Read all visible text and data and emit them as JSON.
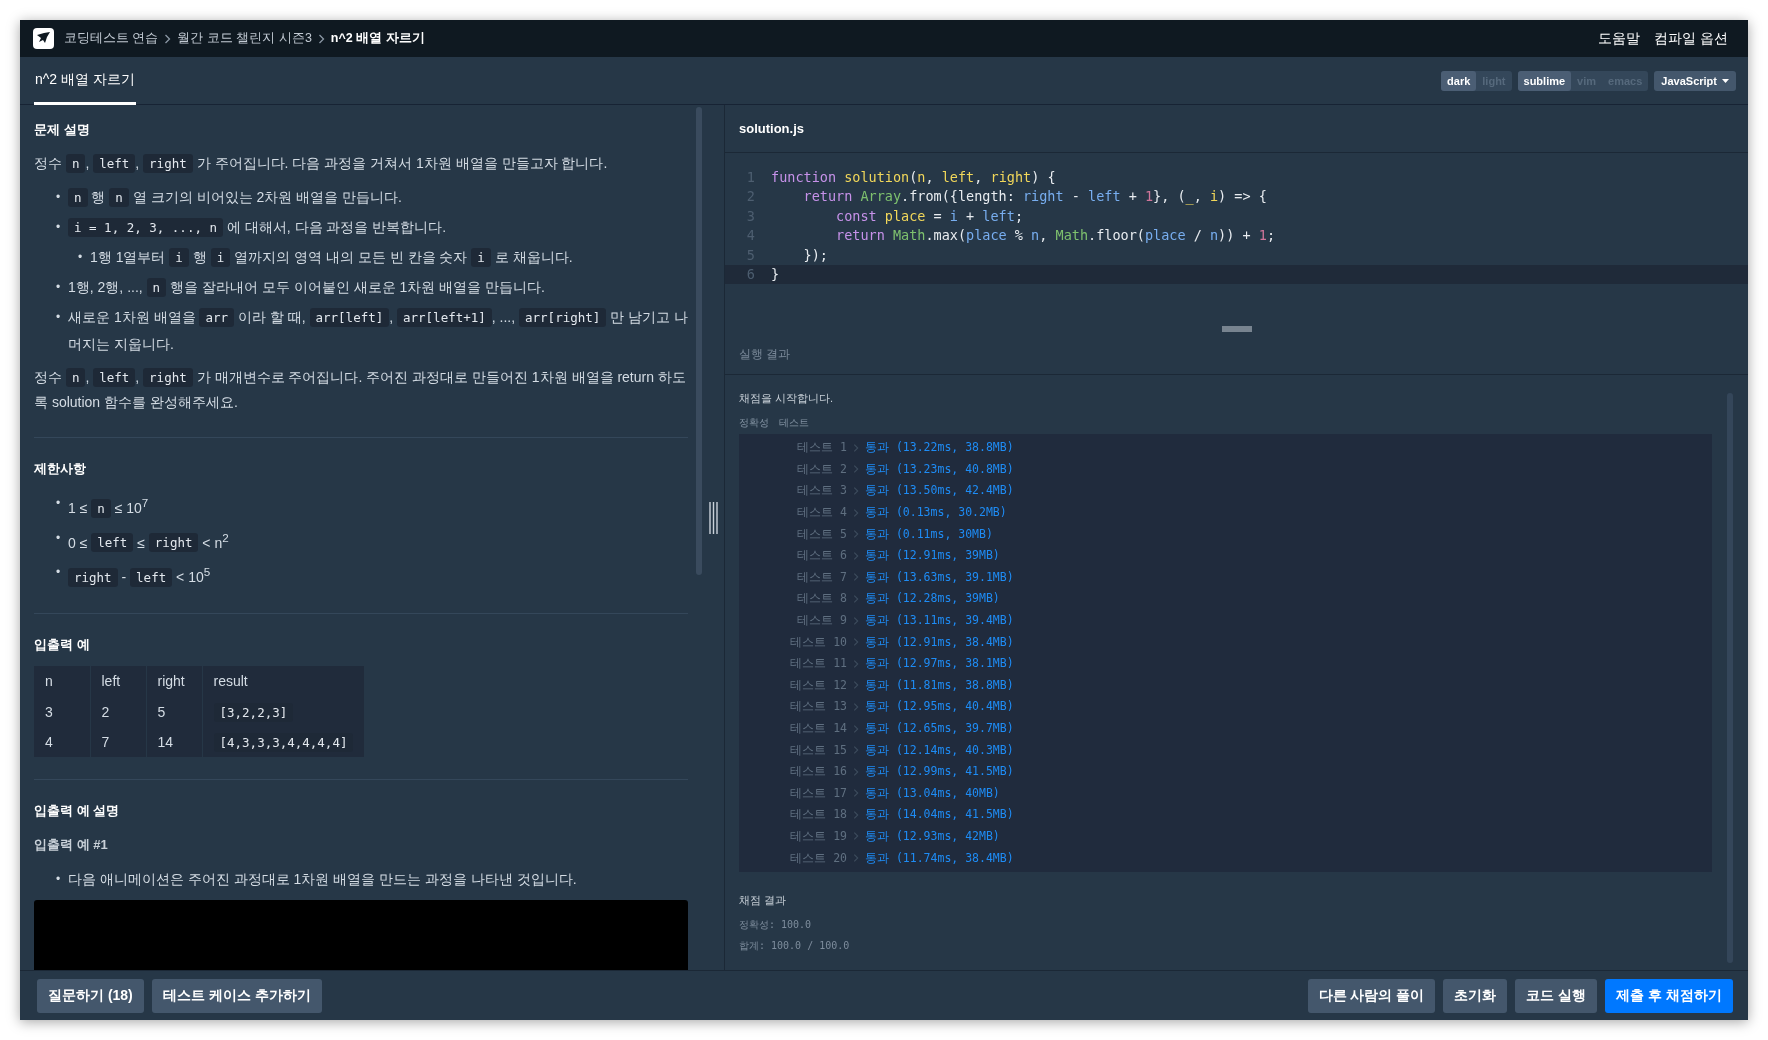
{
  "breadcrumb": [
    {
      "label": "코딩테스트 연습",
      "selected": false
    },
    {
      "label": "월간 코드 챌린지 시즌3",
      "selected": false
    },
    {
      "label": "n^2 배열 자르기",
      "selected": true
    }
  ],
  "top_links": [
    "도움말",
    "컴파일 옵션"
  ],
  "tabs": [
    {
      "label": "n^2 배열 자르기",
      "selected": true
    }
  ],
  "theme_options": [
    {
      "label": "dark",
      "selected": true
    },
    {
      "label": "light",
      "selected": false
    }
  ],
  "keymap_options": [
    {
      "label": "sublime",
      "selected": true
    },
    {
      "label": "vim",
      "selected": false
    },
    {
      "label": "emacs",
      "selected": false
    }
  ],
  "language": "JavaScript",
  "problem": {
    "heading": "문제 설명",
    "intro": [
      {
        "text": "정수 ",
        "kind": "text"
      },
      {
        "text": "n",
        "kind": "code"
      },
      {
        "text": ", ",
        "kind": "text"
      },
      {
        "text": "left",
        "kind": "code"
      },
      {
        "text": ", ",
        "kind": "text"
      },
      {
        "text": "right",
        "kind": "code"
      },
      {
        "text": " 가 주어집니다. 다음 과정을 거쳐서 1차원 배열을 만들고자 합니다.",
        "kind": "text"
      }
    ],
    "steps": [
      {
        "marker": "•",
        "parts": [
          {
            "text": "n",
            "kind": "code"
          },
          {
            "text": " 행 ",
            "kind": "text"
          },
          {
            "text": "n",
            "kind": "code"
          },
          {
            "text": " 열 크기의 비어있는 2차원 배열을 만듭니다.",
            "kind": "text"
          }
        ]
      },
      {
        "marker": "•",
        "parts": [
          {
            "text": "i = 1, 2, 3, ..., n",
            "kind": "code"
          },
          {
            "text": " 에 대해서, 다음 과정을 반복합니다.",
            "kind": "text"
          }
        ],
        "children": [
          {
            "marker": "•",
            "parts": [
              {
                "text": "1행 1열부터 ",
                "kind": "text"
              },
              {
                "text": "i",
                "kind": "code"
              },
              {
                "text": " 행 ",
                "kind": "text"
              },
              {
                "text": "i",
                "kind": "code"
              },
              {
                "text": " 열까지의 영역 내의 모든 빈 칸을 숫자 ",
                "kind": "text"
              },
              {
                "text": "i",
                "kind": "code"
              },
              {
                "text": " 로 채웁니다.",
                "kind": "text"
              }
            ]
          }
        ]
      },
      {
        "marker": "•",
        "parts": [
          {
            "text": "1행, 2행, ..., ",
            "kind": "text"
          },
          {
            "text": "n",
            "kind": "code"
          },
          {
            "text": " 행을 잘라내어 모두 이어붙인 새로운 1차원 배열을 만듭니다.",
            "kind": "text"
          }
        ]
      },
      {
        "marker": "•",
        "parts": [
          {
            "text": "새로운 1차원 배열을 ",
            "kind": "text"
          },
          {
            "text": "arr",
            "kind": "code"
          },
          {
            "text": " 이라 할 때, ",
            "kind": "text"
          },
          {
            "text": "arr[left]",
            "kind": "code"
          },
          {
            "text": ", ",
            "kind": "text"
          },
          {
            "text": "arr[left+1]",
            "kind": "code"
          },
          {
            "text": ", ..., ",
            "kind": "text"
          },
          {
            "text": "arr[right]",
            "kind": "code"
          },
          {
            "text": " 만 남기고 나머지는 지웁니다.",
            "kind": "text"
          }
        ]
      }
    ],
    "task": [
      {
        "text": "정수 ",
        "kind": "text"
      },
      {
        "text": "n",
        "kind": "code"
      },
      {
        "text": ", ",
        "kind": "text"
      },
      {
        "text": "left",
        "kind": "code"
      },
      {
        "text": ", ",
        "kind": "text"
      },
      {
        "text": "right",
        "kind": "code"
      },
      {
        "text": " 가 매개변수로 주어집니다. 주어진 과정대로 만들어진 1차원 배열을 return 하도록 solution 함수를 완성해주세요.",
        "kind": "text"
      }
    ]
  },
  "constraints": {
    "heading": "제한사항",
    "items": [
      {
        "marker": "•",
        "parts": [
          {
            "text": "1 ≤ ",
            "kind": "text"
          },
          {
            "text": "n",
            "kind": "code"
          },
          {
            "text": " ≤ 10$^{7}$",
            "kind": "text"
          }
        ]
      },
      {
        "marker": "•",
        "parts": [
          {
            "text": "0 ≤ ",
            "kind": "text"
          },
          {
            "text": "left",
            "kind": "code"
          },
          {
            "text": " ≤ ",
            "kind": "text"
          },
          {
            "text": "right",
            "kind": "code"
          },
          {
            "text": " < n$^{2}$",
            "kind": "text"
          }
        ]
      },
      {
        "marker": "•",
        "parts": [
          {
            "text": "right",
            "kind": "code"
          },
          {
            "text": " - ",
            "kind": "text"
          },
          {
            "text": "left",
            "kind": "code"
          },
          {
            "text": " < 10$^{5}$",
            "kind": "text"
          }
        ]
      }
    ]
  },
  "examples": {
    "heading": "입출력 예",
    "columns": [
      "n",
      "left",
      "right",
      "result"
    ],
    "rows": [
      [
        "3",
        "2",
        "5",
        "[3,2,2,3]"
      ],
      [
        "4",
        "7",
        "14",
        "[4,3,3,3,4,4,4,4]"
      ]
    ]
  },
  "explanation": {
    "heading": "입출력 예 설명",
    "subheading": "입출력 예 #1",
    "items": [
      {
        "marker": "•",
        "parts": [
          {
            "text": "다음 애니메이션은 주어진 과정대로 1차원 배열을 만드는 과정을 나타낸 것입니다.",
            "kind": "text"
          }
        ]
      }
    ]
  },
  "editor": {
    "filename": "solution.js",
    "lines": [
      {
        "number": "1",
        "current": false,
        "tokens": [
          {
            "text": "function ",
            "kind": "keyword"
          },
          {
            "text": "solution",
            "kind": "name"
          },
          {
            "text": "(",
            "kind": "plain"
          },
          {
            "text": "n",
            "kind": "name"
          },
          {
            "text": ", ",
            "kind": "plain"
          },
          {
            "text": "left",
            "kind": "name"
          },
          {
            "text": ", ",
            "kind": "plain"
          },
          {
            "text": "right",
            "kind": "name"
          },
          {
            "text": ") {",
            "kind": "plain"
          }
        ]
      },
      {
        "number": "2",
        "current": false,
        "tokens": [
          {
            "text": "    return ",
            "kind": "keyword"
          },
          {
            "text": "Array",
            "kind": "builtin"
          },
          {
            "text": ".from({length: ",
            "kind": "plain"
          },
          {
            "text": "right",
            "kind": "variable"
          },
          {
            "text": " - ",
            "kind": "plain"
          },
          {
            "text": "left",
            "kind": "variable"
          },
          {
            "text": " + ",
            "kind": "plain"
          },
          {
            "text": "1",
            "kind": "number"
          },
          {
            "text": "}, (",
            "kind": "plain"
          },
          {
            "text": "_",
            "kind": "name"
          },
          {
            "text": ", ",
            "kind": "plain"
          },
          {
            "text": "i",
            "kind": "name"
          },
          {
            "text": ") => {",
            "kind": "plain"
          }
        ]
      },
      {
        "number": "3",
        "current": false,
        "tokens": [
          {
            "text": "        const ",
            "kind": "keyword"
          },
          {
            "text": "place",
            "kind": "name"
          },
          {
            "text": " = ",
            "kind": "plain"
          },
          {
            "text": "i",
            "kind": "variable"
          },
          {
            "text": " + ",
            "kind": "plain"
          },
          {
            "text": "left",
            "kind": "variable"
          },
          {
            "text": ";",
            "kind": "plain"
          }
        ]
      },
      {
        "number": "4",
        "current": false,
        "tokens": [
          {
            "text": "        return ",
            "kind": "keyword"
          },
          {
            "text": "Math",
            "kind": "builtin"
          },
          {
            "text": ".max(",
            "kind": "plain"
          },
          {
            "text": "place",
            "kind": "variable"
          },
          {
            "text": " % ",
            "kind": "plain"
          },
          {
            "text": "n",
            "kind": "variable"
          },
          {
            "text": ", ",
            "kind": "plain"
          },
          {
            "text": "Math",
            "kind": "builtin"
          },
          {
            "text": ".floor(",
            "kind": "plain"
          },
          {
            "text": "place",
            "kind": "variable"
          },
          {
            "text": " / ",
            "kind": "plain"
          },
          {
            "text": "n",
            "kind": "variable"
          },
          {
            "text": ")) + ",
            "kind": "plain"
          },
          {
            "text": "1",
            "kind": "number"
          },
          {
            "text": ";",
            "kind": "plain"
          }
        ]
      },
      {
        "number": "5",
        "current": false,
        "tokens": [
          {
            "text": "    });",
            "kind": "plain"
          }
        ]
      },
      {
        "number": "6",
        "current": true,
        "tokens": [
          {
            "text": "}",
            "kind": "plain"
          }
        ]
      }
    ]
  },
  "results": {
    "heading": "실행 결과",
    "start": "채점을 시작합니다.",
    "group_labels": [
      "정확성",
      "테스트"
    ],
    "tests": [
      {
        "label": "테스트 1",
        "result": "통과 (13.22ms, 38.8MB)"
      },
      {
        "label": "테스트 2",
        "result": "통과 (13.23ms, 40.8MB)"
      },
      {
        "label": "테스트 3",
        "result": "통과 (13.50ms, 42.4MB)"
      },
      {
        "label": "테스트 4",
        "result": "통과 (0.13ms, 30.2MB)"
      },
      {
        "label": "테스트 5",
        "result": "통과 (0.11ms, 30MB)"
      },
      {
        "label": "테스트 6",
        "result": "통과 (12.91ms, 39MB)"
      },
      {
        "label": "테스트 7",
        "result": "통과 (13.63ms, 39.1MB)"
      },
      {
        "label": "테스트 8",
        "result": "통과 (12.28ms, 39MB)"
      },
      {
        "label": "테스트 9",
        "result": "통과 (13.11ms, 39.4MB)"
      },
      {
        "label": "테스트 10",
        "result": "통과 (12.91ms, 38.4MB)"
      },
      {
        "label": "테스트 11",
        "result": "통과 (12.97ms, 38.1MB)"
      },
      {
        "label": "테스트 12",
        "result": "통과 (11.81ms, 38.8MB)"
      },
      {
        "label": "테스트 13",
        "result": "통과 (12.95ms, 40.4MB)"
      },
      {
        "label": "테스트 14",
        "result": "통과 (12.65ms, 39.7MB)"
      },
      {
        "label": "테스트 15",
        "result": "통과 (12.14ms, 40.3MB)"
      },
      {
        "label": "테스트 16",
        "result": "통과 (12.99ms, 41.5MB)"
      },
      {
        "label": "테스트 17",
        "result": "통과 (13.04ms, 40MB)"
      },
      {
        "label": "테스트 18",
        "result": "통과 (14.04ms, 41.5MB)"
      },
      {
        "label": "테스트 19",
        "result": "통과 (12.93ms, 42MB)"
      },
      {
        "label": "테스트 20",
        "result": "통과 (11.74ms, 38.4MB)"
      }
    ],
    "summary_heading": "채점 결과",
    "summary": [
      "정확성: 100.0",
      "합계: 100.0 / 100.0"
    ]
  },
  "left_buttons": [
    {
      "label": "질문하기 (18)",
      "kind": "secondary"
    },
    {
      "label": "테스트 케이스 추가하기",
      "kind": "secondary"
    }
  ],
  "right_buttons": [
    {
      "label": "다른 사람의 풀이",
      "kind": "secondary"
    },
    {
      "label": "초기화",
      "kind": "secondary"
    },
    {
      "label": "코드 실행",
      "kind": "secondary"
    },
    {
      "label": "제출 후 채점하기",
      "kind": "primary"
    }
  ]
}
